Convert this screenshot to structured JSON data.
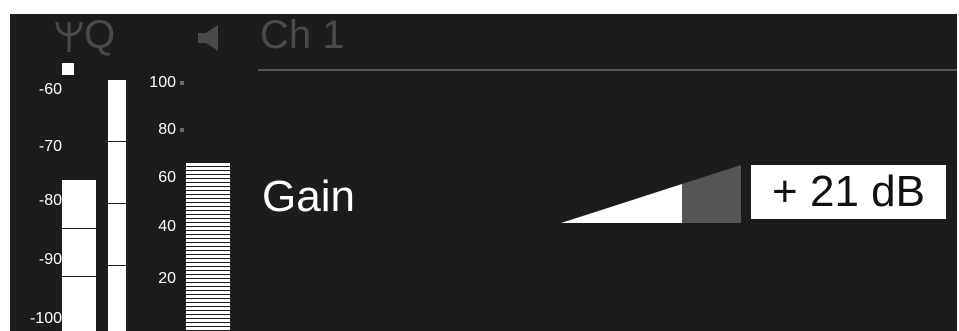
{
  "header": {
    "antenna_icon": "antenna-icon",
    "q_label": "Q",
    "speaker_icon": "speaker-icon",
    "channel": "Ch 1"
  },
  "rf_scale": [
    "-60",
    "-70",
    "-80",
    "-90",
    "-100"
  ],
  "af_scale": [
    "100",
    "80",
    "60",
    "40",
    "20"
  ],
  "gain": {
    "label": "Gain",
    "value": "+ 21 dB"
  },
  "colors": {
    "background": "#1c1c1c",
    "dim_text": "#4a4a4a",
    "foreground": "#ffffff",
    "ramp_inactive": "#555555"
  }
}
